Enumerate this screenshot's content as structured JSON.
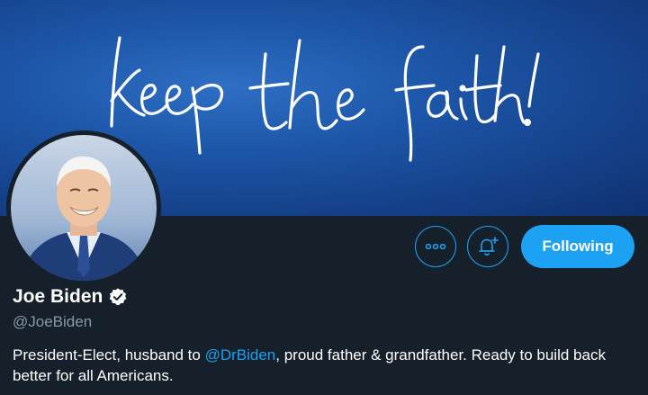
{
  "banner": {
    "handwriting": "keep the faith!",
    "background_color": "#1d56a8"
  },
  "profile": {
    "name": "Joe Biden",
    "verified": true,
    "handle": "@JoeBiden",
    "bio": {
      "before_mention": "President-Elect, husband to ",
      "mention": "@DrBiden",
      "after_mention": ", proud father & grandfather. Ready to build back better for all Americans."
    }
  },
  "actions": {
    "more_icon": "more-horizontal-icon",
    "notify_icon": "bell-plus-icon",
    "follow_label": "Following"
  },
  "colors": {
    "accent": "#1da1f2",
    "background": "#15202b",
    "secondary_text": "#8899a6"
  }
}
